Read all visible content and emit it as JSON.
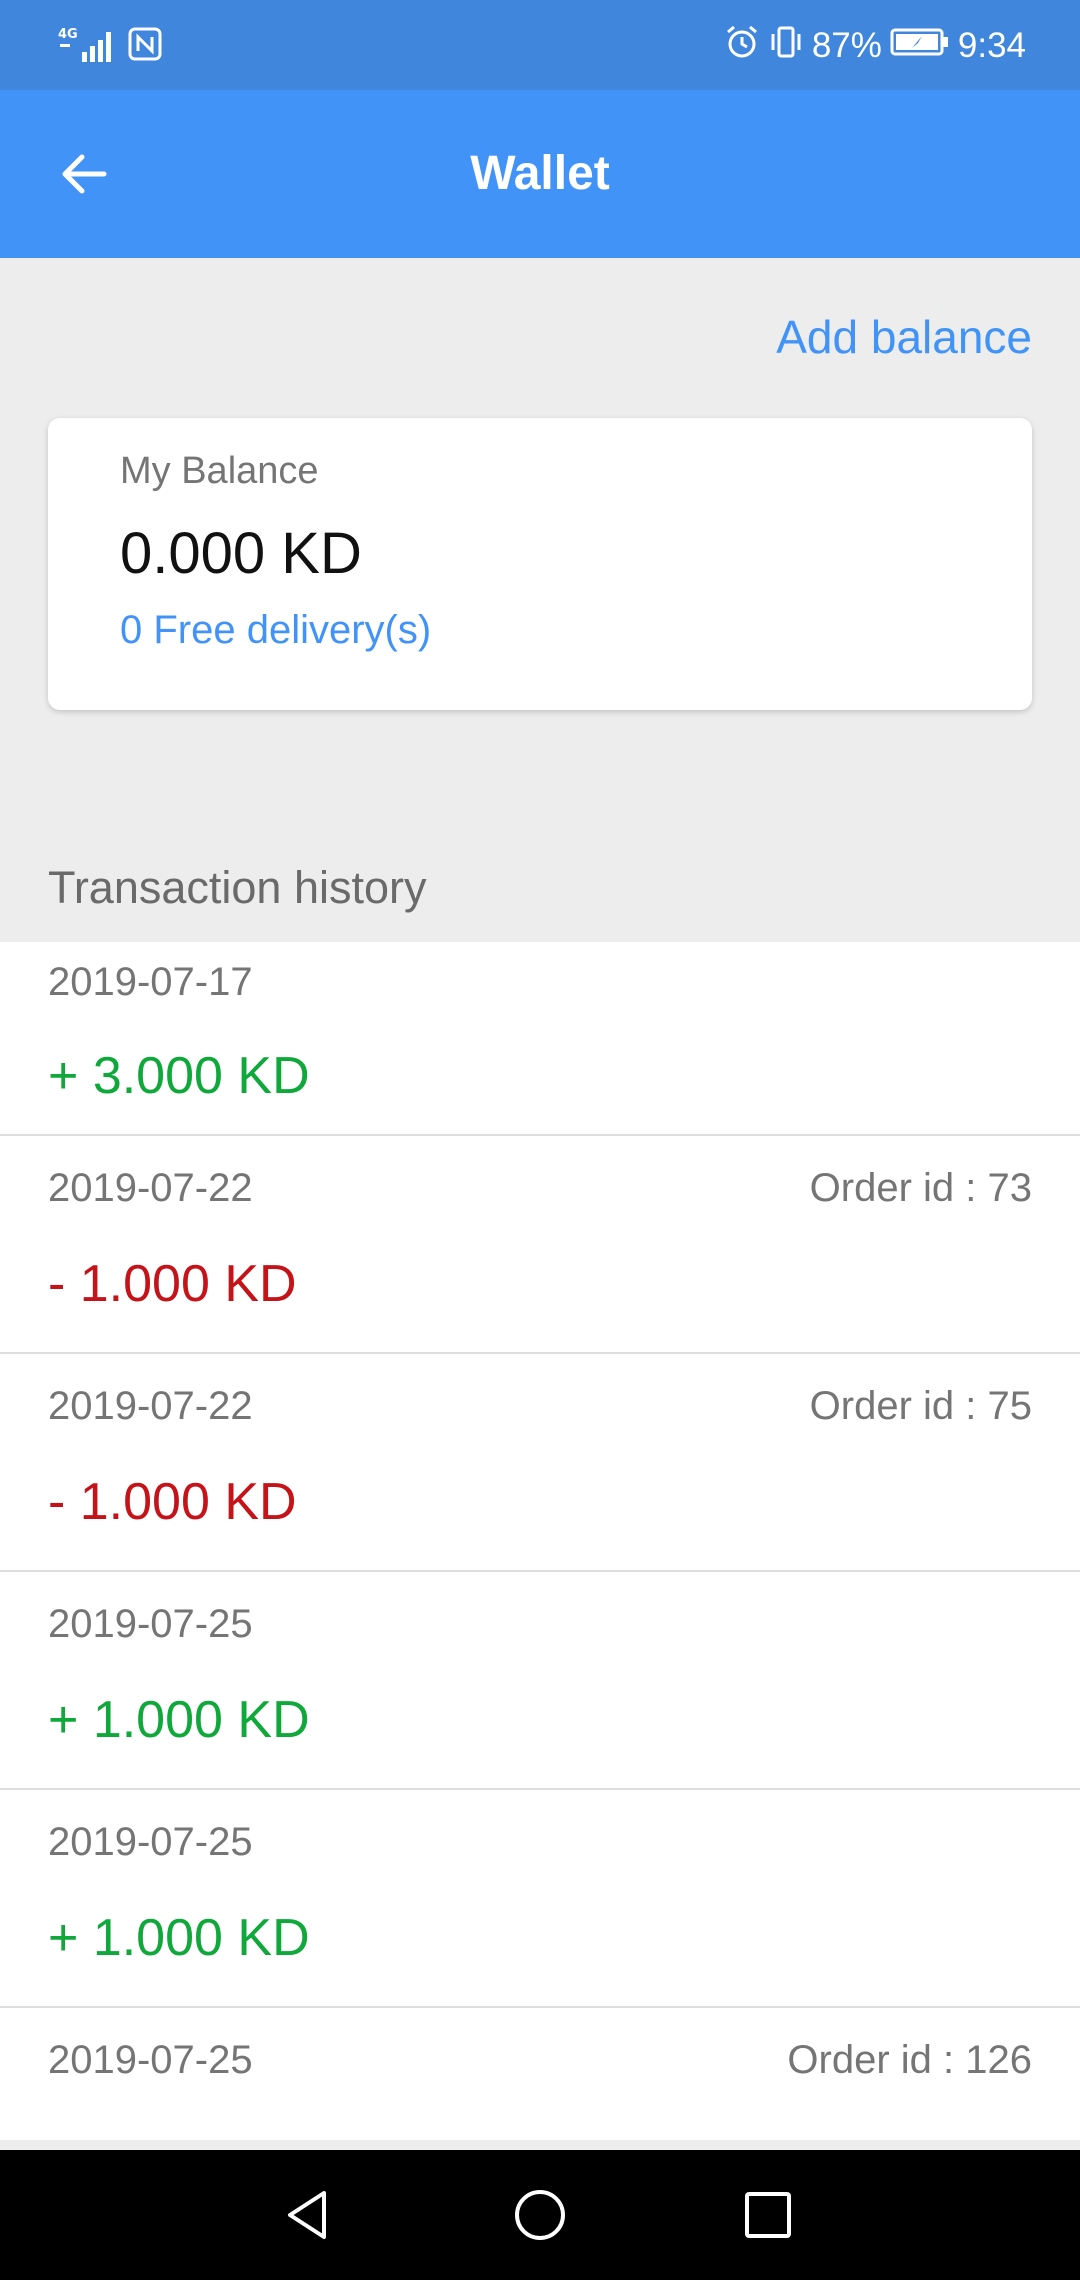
{
  "status_bar": {
    "network": "4G",
    "battery": "87%",
    "time": "9:34"
  },
  "app_bar": {
    "title": "Wallet",
    "back_icon": "arrow-left-icon"
  },
  "actions": {
    "add_balance": "Add balance"
  },
  "balance_card": {
    "label": "My Balance",
    "amount": "0.000 KD",
    "free_deliveries": "0 Free delivery(s)"
  },
  "history": {
    "title": "Transaction history",
    "transactions": [
      {
        "date": "2019-07-17",
        "order": "",
        "amount": "+ 3.000 KD",
        "type": "credit"
      },
      {
        "date": "2019-07-22",
        "order": "Order id : 73",
        "amount": "- 1.000 KD",
        "type": "debit"
      },
      {
        "date": "2019-07-22",
        "order": "Order id : 75",
        "amount": "- 1.000 KD",
        "type": "debit"
      },
      {
        "date": "2019-07-25",
        "order": "",
        "amount": "+ 1.000 KD",
        "type": "credit"
      },
      {
        "date": "2019-07-25",
        "order": "",
        "amount": "+ 1.000 KD",
        "type": "credit"
      },
      {
        "date": "2019-07-25",
        "order": "Order id : 126",
        "amount": "",
        "type": ""
      }
    ]
  },
  "colors": {
    "primary": "#4293f8",
    "status_bar": "#3f86dc",
    "credit": "#0fa83a",
    "debit": "#c4141a"
  },
  "nav": {
    "back": "triangle-back-icon",
    "home": "circle-home-icon",
    "recents": "square-recents-icon"
  }
}
